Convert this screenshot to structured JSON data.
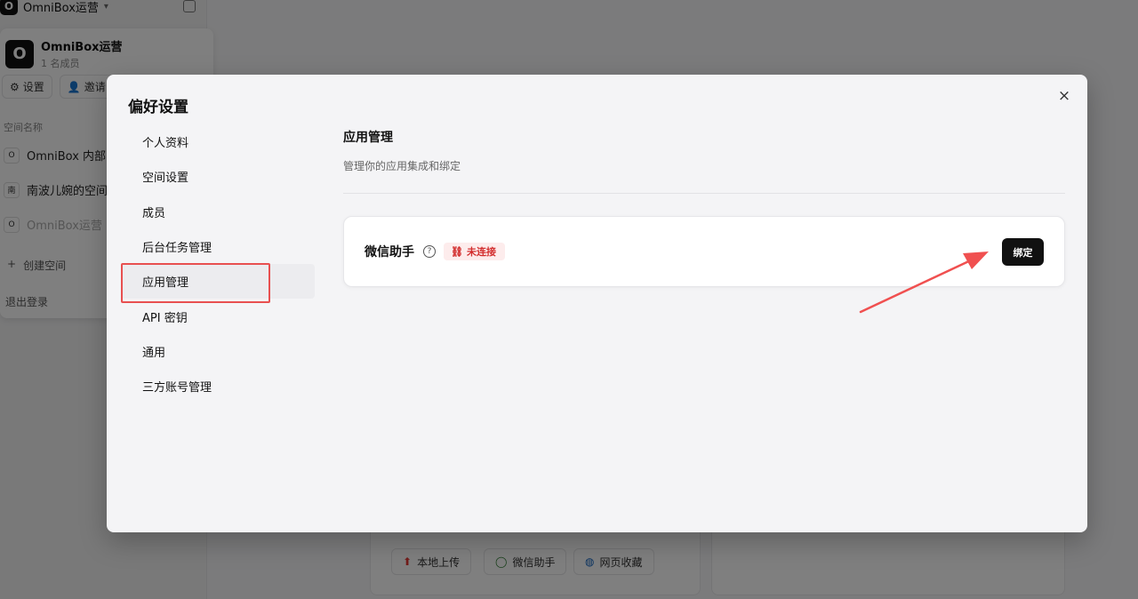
{
  "background": {
    "workspace_selector": "OmniBox运营",
    "workspace_card": {
      "logo_letter": "O",
      "name": "OmniBox运营",
      "members": "1 名成员",
      "settings_btn": "设置",
      "invite_btn": "邀请",
      "section_label": "空间名称",
      "spaces": [
        {
          "initial": "O",
          "name": "OmniBox 内部"
        },
        {
          "initial": "南",
          "name": "南波儿婉的空间"
        },
        {
          "initial": "O",
          "name": "OmniBox运营"
        }
      ],
      "create_space": "创建空间",
      "logout": "退出登录"
    },
    "bottom_chips": [
      {
        "label": "本地上传",
        "icon": "upload-icon"
      },
      {
        "label": "微信助手",
        "icon": "wechat-icon"
      },
      {
        "label": "网页收藏",
        "icon": "globe-icon"
      }
    ]
  },
  "modal": {
    "title": "偏好设置",
    "close_icon": "×",
    "nav": [
      {
        "label": "个人资料"
      },
      {
        "label": "空间设置"
      },
      {
        "label": "成员"
      },
      {
        "label": "后台任务管理"
      },
      {
        "label": "应用管理",
        "active": true
      },
      {
        "label": "API 密钥"
      },
      {
        "label": "通用"
      },
      {
        "label": "三方账号管理"
      }
    ],
    "section": {
      "title": "应用管理",
      "description": "管理你的应用集成和绑定"
    },
    "app": {
      "name": "微信助手",
      "help_icon": "?",
      "status": "未连接",
      "status_color": "#d32f2f",
      "bind_label": "绑定"
    }
  },
  "colors": {
    "highlight_box": "#e85050",
    "arrow": "#f05050"
  }
}
